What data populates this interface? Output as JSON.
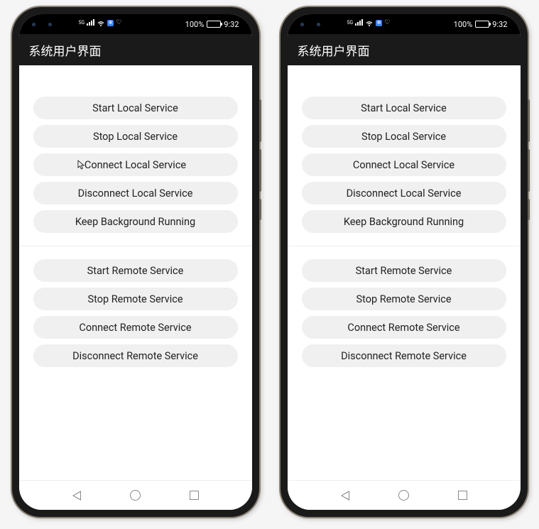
{
  "status_bar": {
    "network_type": "5G",
    "battery_percent": "100%",
    "time": "9:32"
  },
  "app_bar": {
    "title": "系统用户界面"
  },
  "local_buttons": [
    {
      "label": "Start Local Service",
      "name": "start-local-service-button"
    },
    {
      "label": "Stop Local Service",
      "name": "stop-local-service-button"
    },
    {
      "label": "Connect Local Service",
      "name": "connect-local-service-button"
    },
    {
      "label": "Disconnect Local Service",
      "name": "disconnect-local-service-button"
    },
    {
      "label": "Keep Background Running",
      "name": "keep-background-running-button"
    }
  ],
  "remote_buttons": [
    {
      "label": "Start Remote Service",
      "name": "start-remote-service-button"
    },
    {
      "label": "Stop Remote Service",
      "name": "stop-remote-service-button"
    },
    {
      "label": "Connect Remote Service",
      "name": "connect-remote-service-button"
    },
    {
      "label": "Disconnect Remote Service",
      "name": "disconnect-remote-service-button"
    }
  ],
  "phones": [
    {
      "id": "phone-left",
      "show_cursor": true,
      "cursor_on_index": 2
    },
    {
      "id": "phone-right",
      "show_cursor": false,
      "cursor_on_index": -1
    }
  ]
}
